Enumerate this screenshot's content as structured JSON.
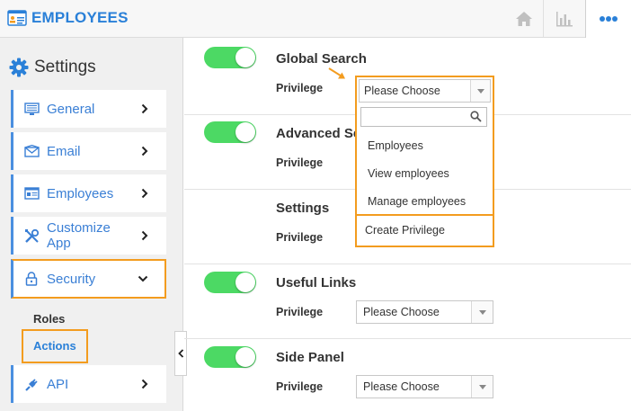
{
  "header": {
    "title": "EMPLOYEES",
    "icons": [
      "employees-logo-icon",
      "home-icon",
      "bar-chart-icon",
      "more-icon"
    ]
  },
  "sidebar": {
    "heading": "Settings",
    "items": [
      {
        "label": "General",
        "icon": "monitor-icon"
      },
      {
        "label": "Email",
        "icon": "envelope-icon"
      },
      {
        "label": "Employees",
        "icon": "id-card-icon"
      },
      {
        "label": "Customize App",
        "icon": "tools-icon"
      },
      {
        "label": "Security",
        "icon": "lock-icon"
      },
      {
        "label": "API",
        "icon": "plug-icon"
      }
    ],
    "sub_items": [
      {
        "label": "Roles"
      },
      {
        "label": "Actions"
      }
    ]
  },
  "main": {
    "privilege_label": "Privilege",
    "rows": [
      {
        "title": "Global Search",
        "toggle_on": true,
        "select_value": "Please Choose"
      },
      {
        "title": "Advanced Se",
        "toggle_on": true,
        "select_value": ""
      },
      {
        "title": "Settings",
        "toggle_on": false,
        "select_value": ""
      },
      {
        "title": "Useful Links",
        "toggle_on": true,
        "select_value": "Please Choose"
      },
      {
        "title": "Side Panel",
        "toggle_on": true,
        "select_value": "Please Choose"
      }
    ]
  },
  "dropdown": {
    "selected": "Please Choose",
    "search_value": "",
    "options": [
      "Employees",
      "View employees",
      "Manage employees"
    ],
    "create_label": "Create Privilege"
  },
  "colors": {
    "accent": "#2a80d8",
    "highlight": "#f39c1f",
    "toggle_on": "#4cd964"
  }
}
